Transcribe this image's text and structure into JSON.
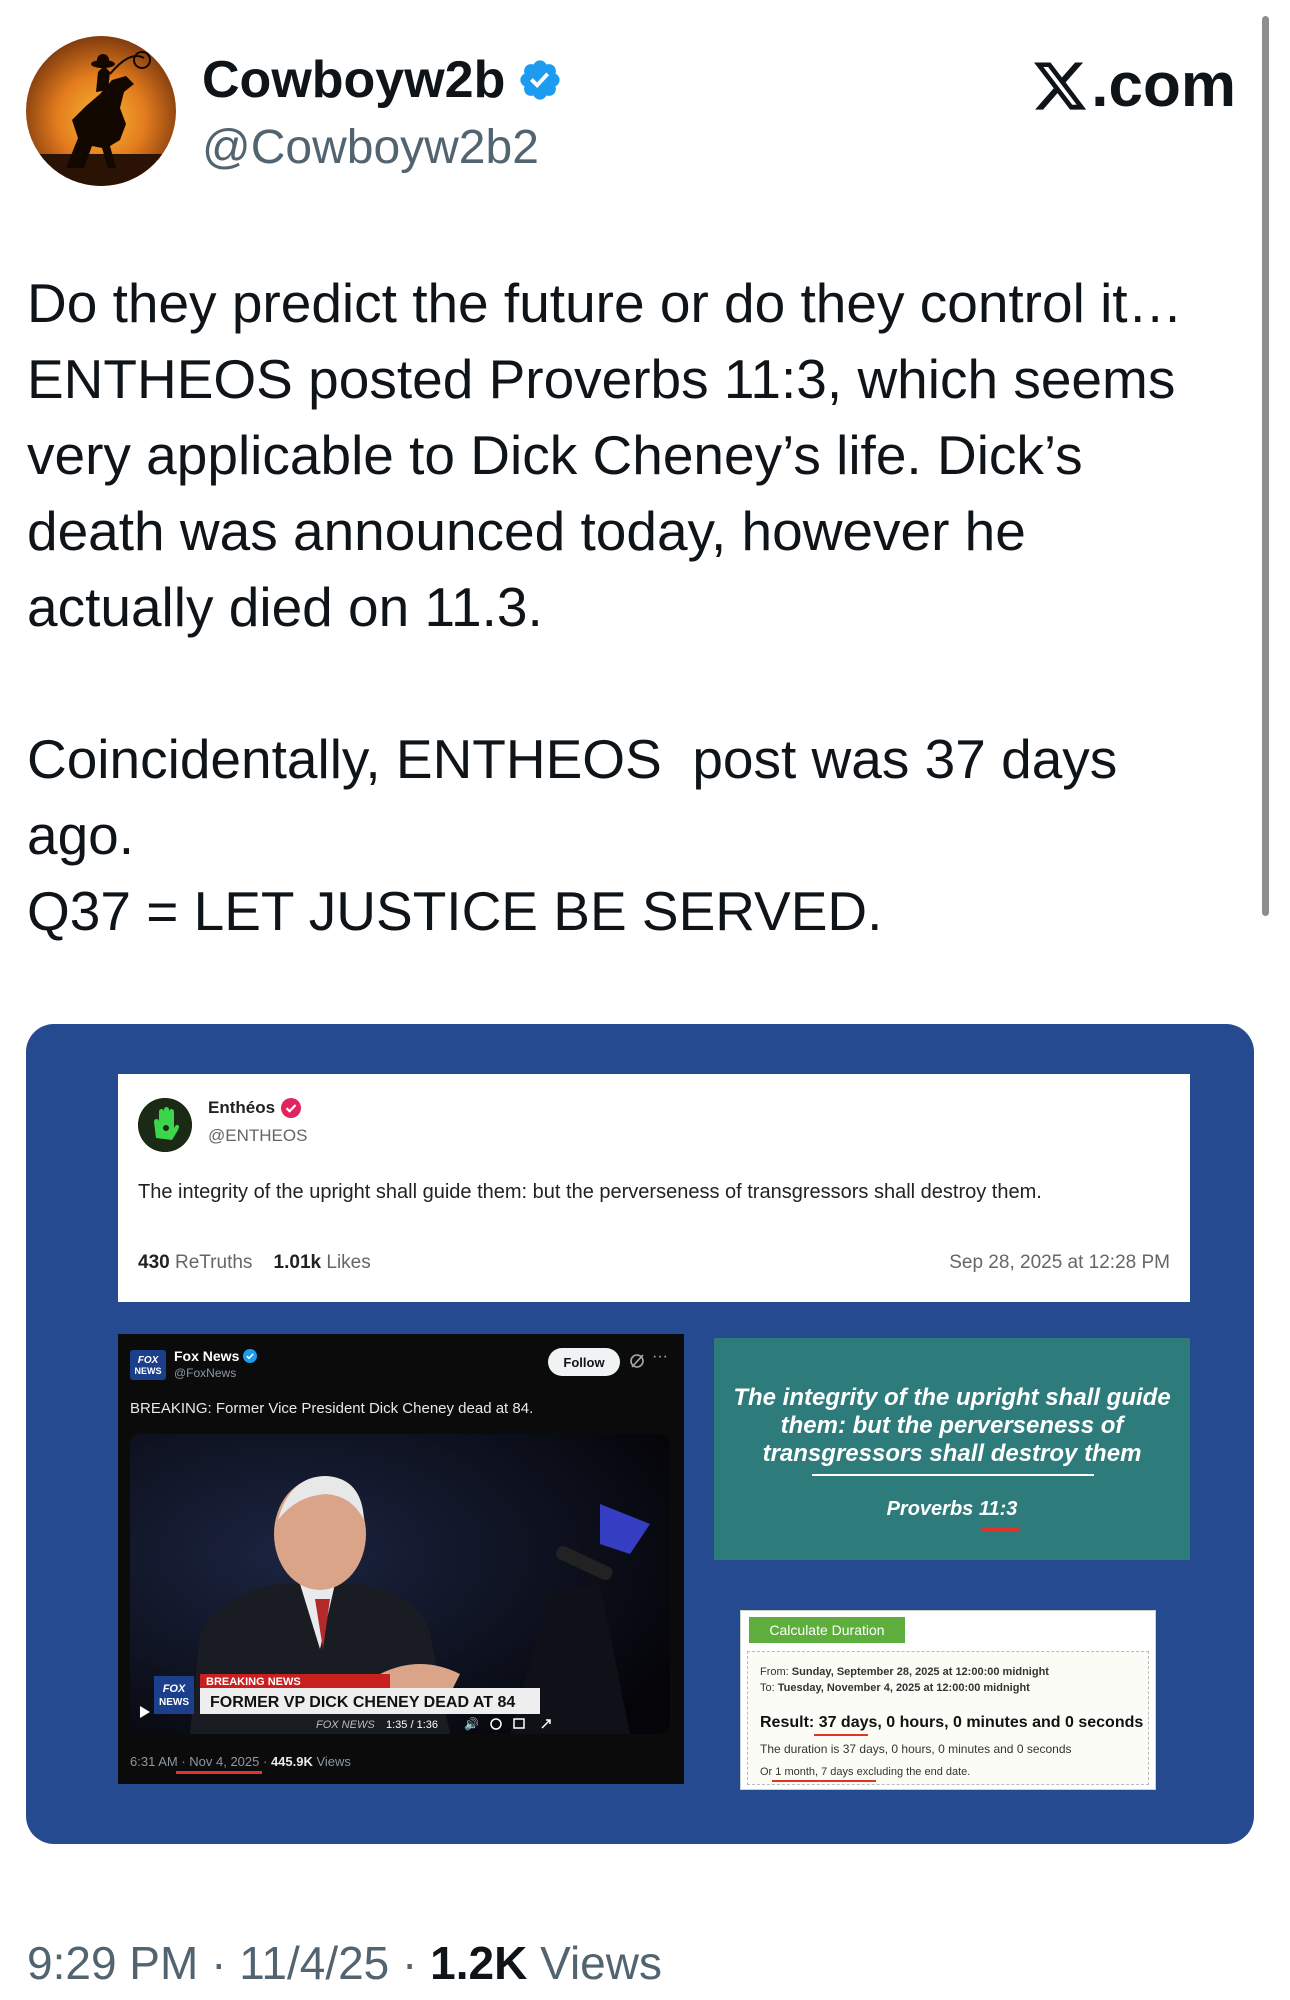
{
  "author": {
    "display_name": "Cowboyw2b",
    "handle": "@Cowboyw2b2",
    "site": ".com",
    "site_logo": "x-logo"
  },
  "tweet": {
    "para1": "Do they predict the future or do they control it…\nENTHEOS posted Proverbs 11:3, which seems\nvery applicable to Dick Cheney’s life. Dick’s\ndeath was announced today, however he\nactually died on 11.3.",
    "para2": "Coincidentally, ENTHEOS  post was 37 days\nago.\nQ37 = LET JUSTICE BE SERVED."
  },
  "media": {
    "entheos_post": {
      "name": "Enthéos",
      "handle": "@ENTHEOS",
      "text": "The integrity of the upright shall guide them: but the perverseness of transgressors shall destroy them.",
      "retruths_count": "430",
      "retruths_label": "ReTruths",
      "likes_count": "1.01k",
      "likes_label": "Likes",
      "date": "Sep 28, 2025 at 12:28 PM"
    },
    "fox_post": {
      "name": "Fox News",
      "handle": "@FoxNews",
      "follow_label": "Follow",
      "text": "BREAKING: Former Vice President Dick Cheney dead at 84.",
      "breaking_banner": "BREAKING NEWS",
      "chyron": "FORMER VP DICK CHENEY DEAD AT 84",
      "fox_logo_line1": "FOX",
      "fox_logo_line2": "NEWS",
      "channel_bug": "FOX NEWS",
      "video_time": "1:35 / 1:36",
      "timestamp_time": "6:31 AM",
      "timestamp_date": "Nov 4, 2025",
      "views_count": "445.9K",
      "views_label": "Views"
    },
    "verse_card": {
      "text": "The integrity of the upright shall guide them: but the perverseness of transgressors shall destroy them",
      "reference": "Proverbs 11:3"
    },
    "calculator": {
      "button_label": "Calculate Duration",
      "from_label": "From:",
      "from_value": "Sunday, September 28, 2025 at 12:00:00 midnight",
      "to_label": "To:",
      "to_value": "Tuesday, November 4, 2025 at 12:00:00 midnight",
      "result_label": "Result:",
      "result_days": "37 days,",
      "result_rest": "0 hours, 0 minutes and 0 seconds",
      "duration_text": "The duration is 37 days, 0 hours, 0 minutes and 0 seconds",
      "or_text": "Or 1 month, 7 days excluding the end date."
    }
  },
  "footer": {
    "time": "9:29 PM",
    "date": "11/4/25",
    "views_count": "1.2K",
    "views_label": "Views"
  },
  "colors": {
    "media_bg": "#254a8f",
    "verse_bg": "#2e7b7c",
    "verified_blue": "#1d9bf0",
    "entheos_badge": "#e0245e",
    "calc_green": "#5eae3e",
    "underline_red": "#e0342b"
  }
}
